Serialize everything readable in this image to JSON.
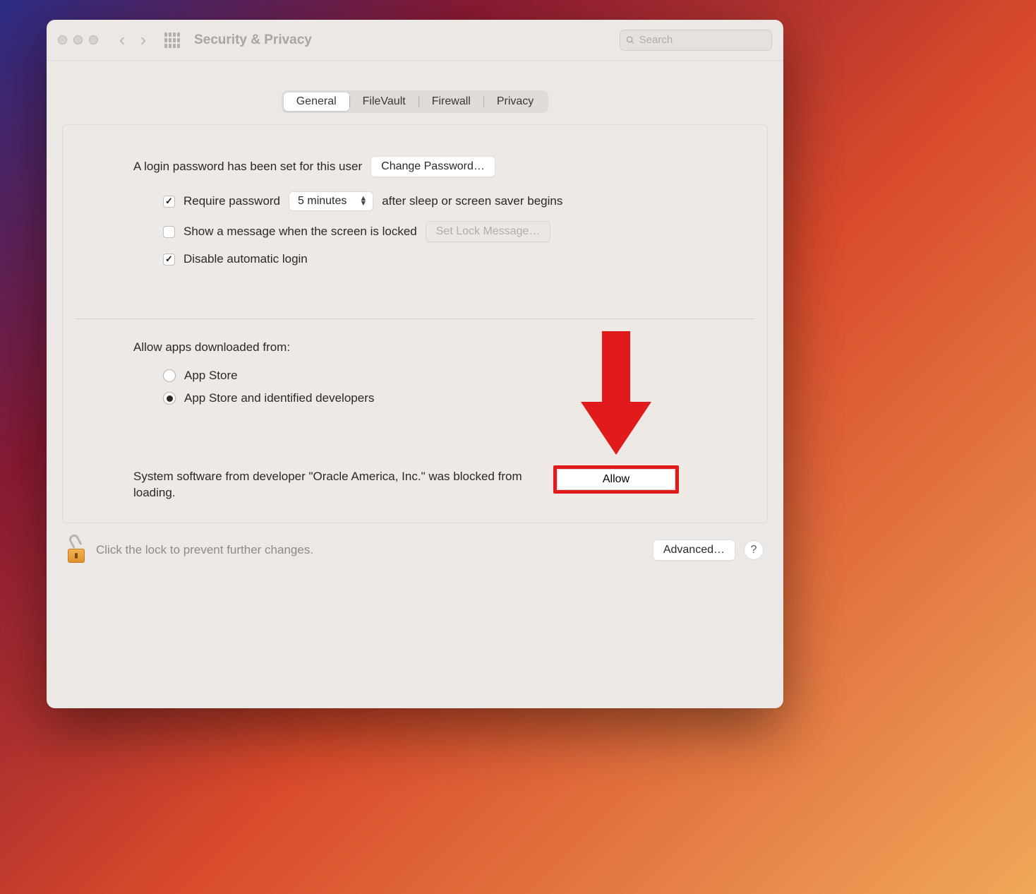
{
  "window": {
    "title": "Security & Privacy",
    "search_placeholder": "Search"
  },
  "tabs": [
    {
      "label": "General",
      "active": true
    },
    {
      "label": "FileVault",
      "active": false
    },
    {
      "label": "Firewall",
      "active": false
    },
    {
      "label": "Privacy",
      "active": false
    }
  ],
  "login": {
    "password_set_text": "A login password has been set for this user",
    "change_password_label": "Change Password…",
    "require_password_label": "Require password",
    "require_password_checked": true,
    "delay_selected": "5 minutes",
    "after_sleep_text": "after sleep or screen saver begins",
    "show_message_label": "Show a message when the screen is locked",
    "show_message_checked": false,
    "set_lock_message_label": "Set Lock Message…",
    "disable_auto_login_label": "Disable automatic login",
    "disable_auto_login_checked": true
  },
  "gatekeeper": {
    "heading": "Allow apps downloaded from:",
    "options": [
      {
        "label": "App Store",
        "selected": false
      },
      {
        "label": "App Store and identified developers",
        "selected": true
      }
    ],
    "blocked_text": "System software from developer \"Oracle America, Inc.\" was blocked from loading.",
    "allow_label": "Allow"
  },
  "footer": {
    "text": "Click the lock to prevent further changes.",
    "advanced_label": "Advanced…",
    "help_label": "?"
  },
  "annotation": {
    "type": "highlight-arrow",
    "target": "allow-button",
    "color": "#e11b1b"
  }
}
